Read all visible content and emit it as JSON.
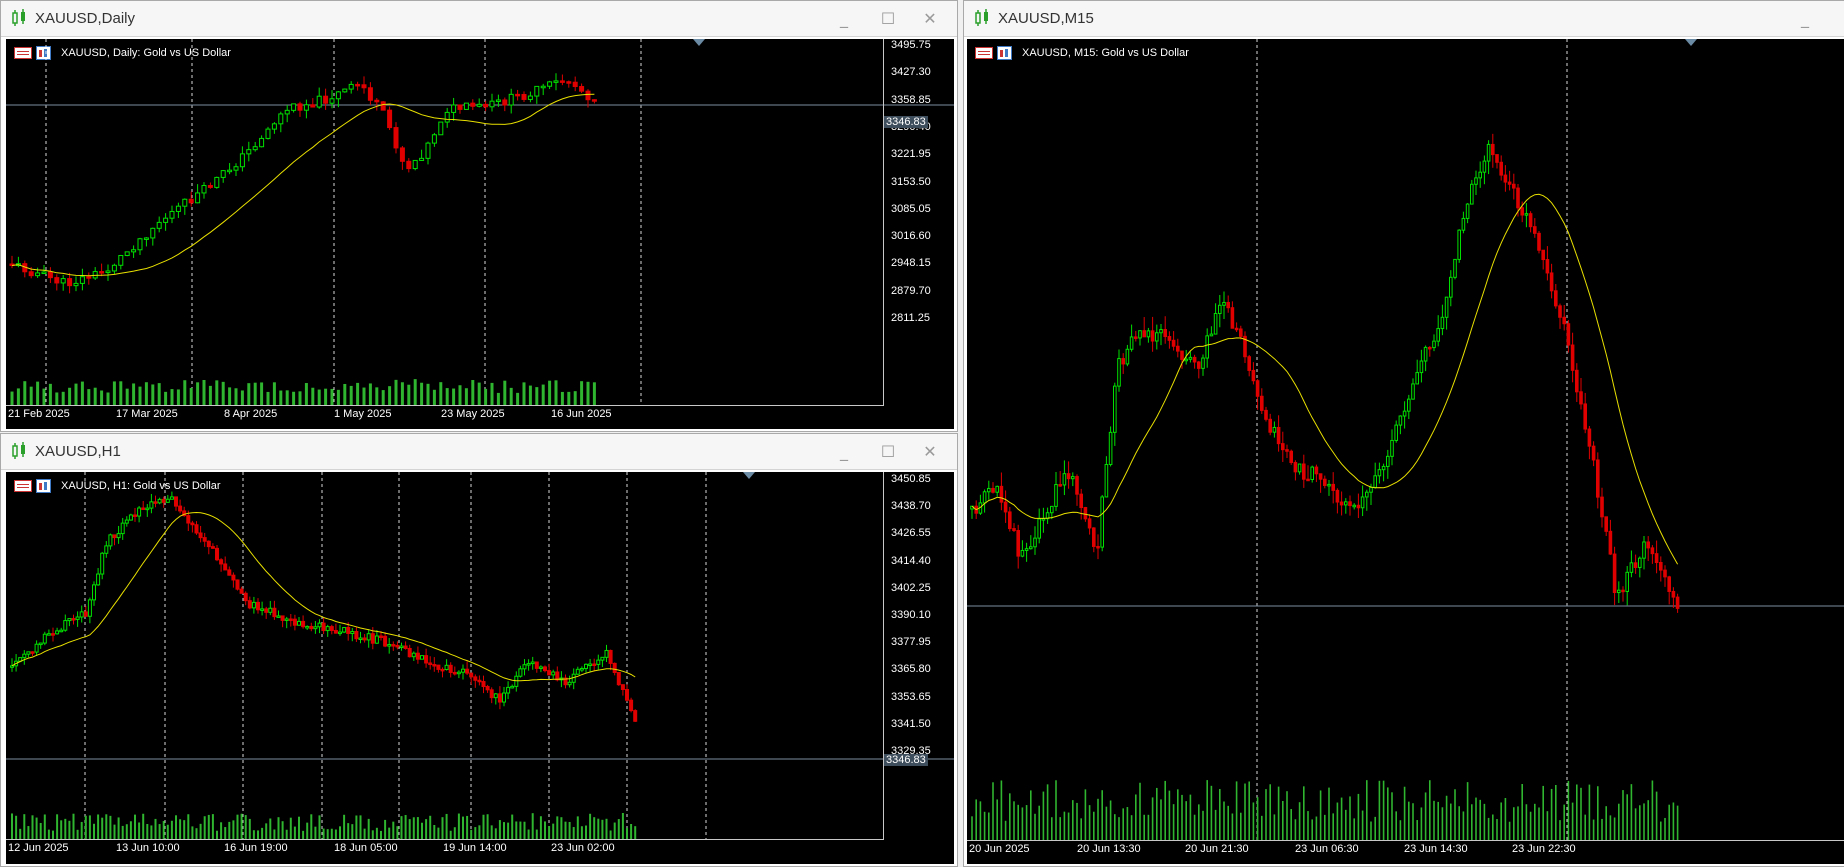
{
  "colors": {
    "bull": "#00e000",
    "bear": "#e00000",
    "ma": "#e8e000",
    "volume": "#2fb52f",
    "grid": "#ffffff",
    "bid_line": "#7d8e9e"
  },
  "windows": {
    "daily": {
      "title": "XAUUSD,Daily",
      "header": "XAUUSD, Daily:  Gold vs US Dollar",
      "price_tag": "3346.83",
      "y_labels": [
        "3495.75",
        "3427.30",
        "3358.85",
        "3290.40",
        "3221.95",
        "3153.50",
        "3085.05",
        "3016.60",
        "2948.15",
        "2879.70",
        "2811.25"
      ],
      "x_labels": [
        "21 Feb 2025",
        "17 Mar 2025",
        "8 Apr 2025",
        "1 May 2025",
        "23 May 2025",
        "16 Jun 2025"
      ],
      "controls": {
        "minimize": "_",
        "maximize": "☐",
        "close": "✕"
      }
    },
    "h1": {
      "title": "XAUUSD,H1",
      "header": "XAUUSD, H1:  Gold vs US Dollar",
      "price_tag": "3346.83",
      "y_labels": [
        "3450.85",
        "3438.70",
        "3426.55",
        "3414.40",
        "3402.25",
        "3390.10",
        "3377.95",
        "3365.80",
        "3353.65",
        "3341.50",
        "3329.35"
      ],
      "x_labels": [
        "12 Jun 2025",
        "13 Jun 10:00",
        "16 Jun 19:00",
        "18 Jun 05:00",
        "19 Jun 14:00",
        "23 Jun 02:00"
      ],
      "controls": {
        "minimize": "_",
        "maximize": "☐",
        "close": "✕"
      }
    },
    "m15": {
      "title": "XAUUSD,M15",
      "header": "XAUUSD, M15:  Gold vs US Dollar",
      "x_labels": [
        "20 Jun 2025",
        "20 Jun 13:30",
        "20 Jun 21:30",
        "23 Jun 06:30",
        "23 Jun 14:30",
        "23 Jun 22:30"
      ],
      "controls": {
        "minimize": "_"
      }
    }
  }
}
